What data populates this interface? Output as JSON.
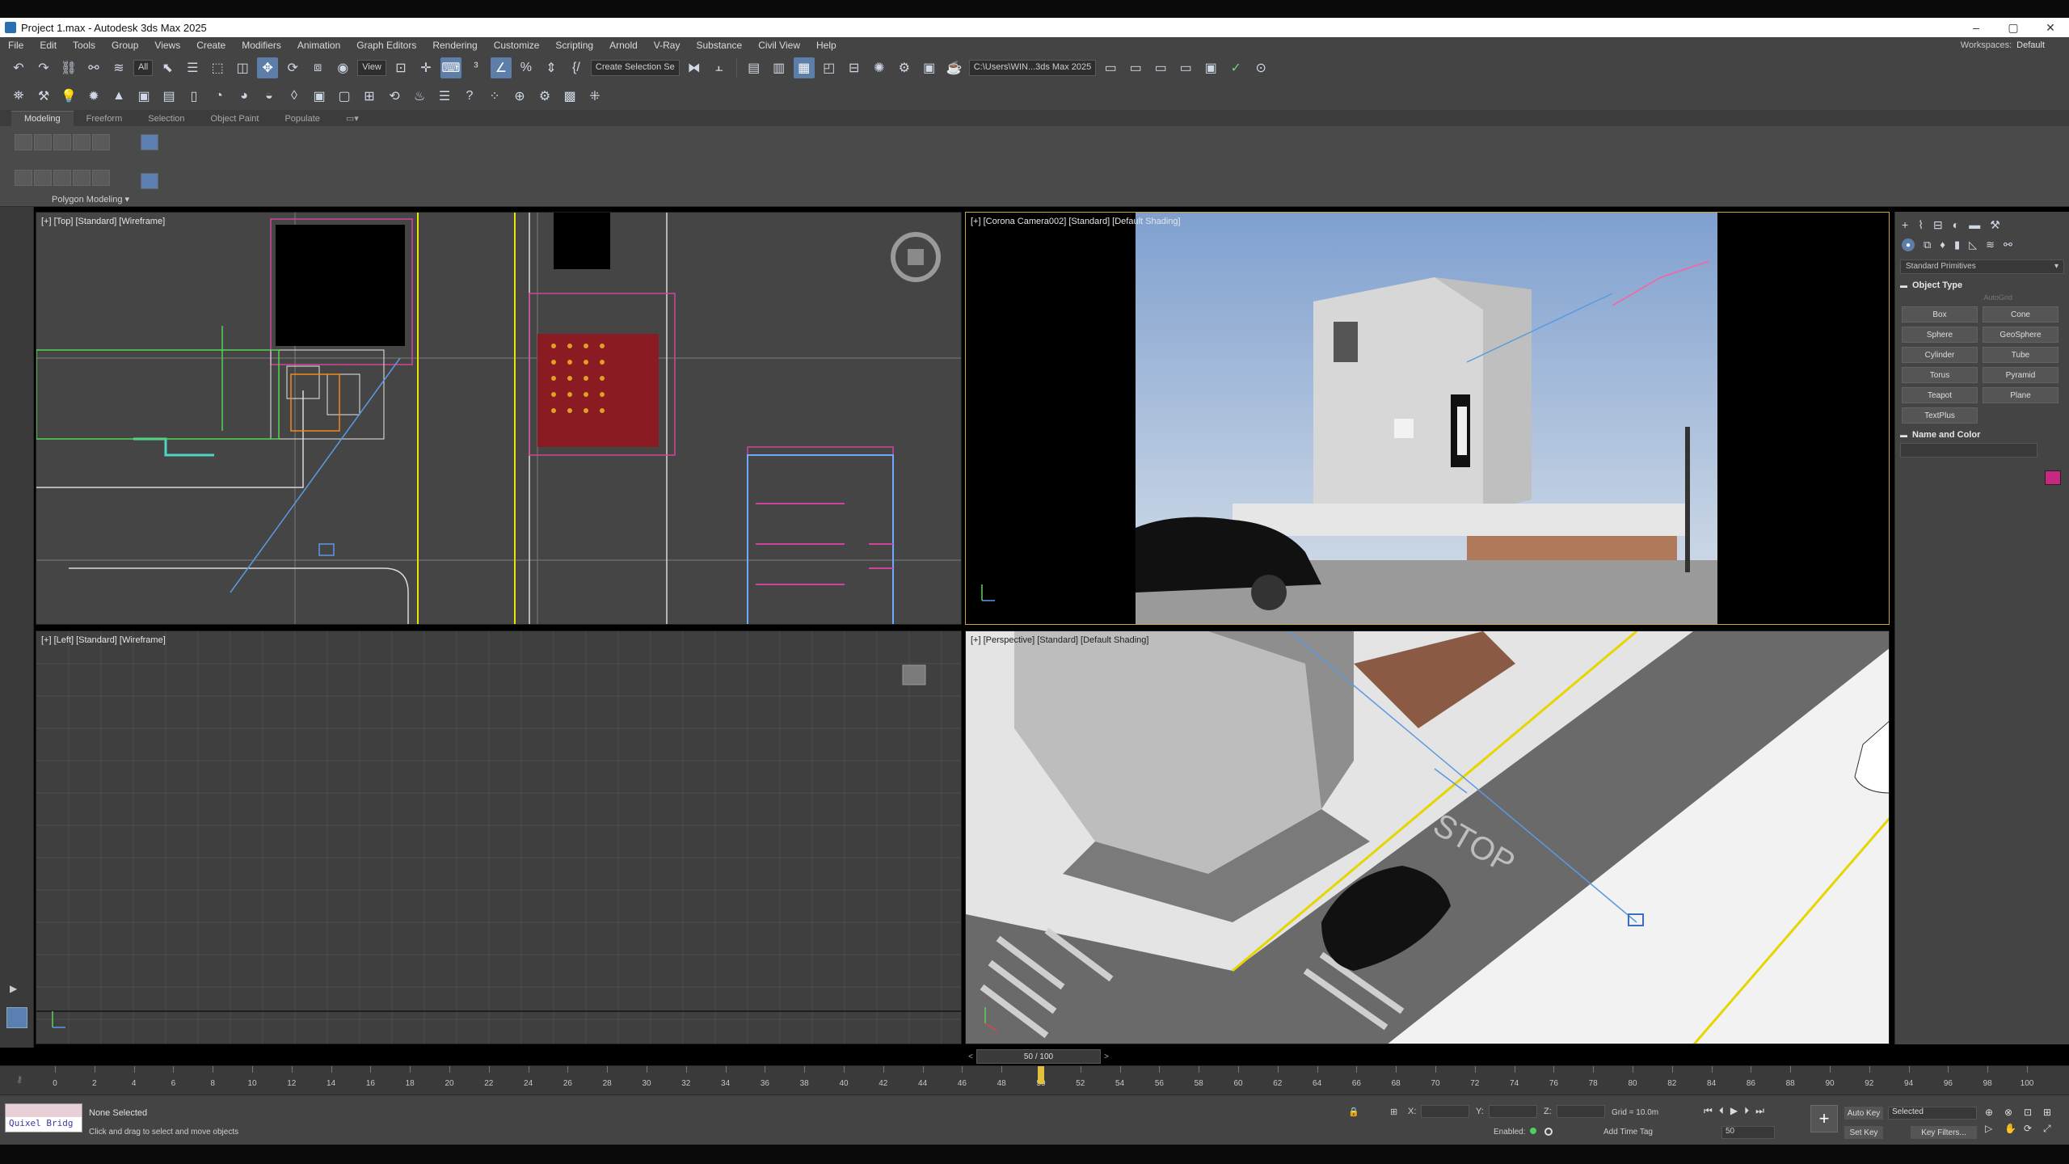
{
  "window": {
    "title": "Project 1.max - Autodesk 3ds Max 2025",
    "controls": [
      "–",
      "▢",
      "✕"
    ]
  },
  "menu": {
    "items": [
      "File",
      "Edit",
      "Tools",
      "Group",
      "Views",
      "Create",
      "Modifiers",
      "Animation",
      "Graph Editors",
      "Rendering",
      "Customize",
      "Scripting",
      "Arnold",
      "V-Ray",
      "Substance",
      "Civil View",
      "Help"
    ],
    "workspaces_label": "Workspaces:",
    "workspaces_value": "Default"
  },
  "toolbar": {
    "selection_filter": "All",
    "ref_coord": "View",
    "named_selection": "Create Selection Se",
    "project_path": "C:\\Users\\WIN...3ds Max 2025"
  },
  "ribbon": {
    "tabs": [
      "Modeling",
      "Freeform",
      "Selection",
      "Object Paint",
      "Populate"
    ],
    "active_tab": "Modeling",
    "panel_label": "Polygon Modeling"
  },
  "viewports": {
    "top_left": "[+] [Top] [Standard] [Wireframe]",
    "top_right": "[+] [Corona Camera002] [Standard] [Default Shading]",
    "bottom_left": "[+] [Left] [Standard] [Wireframe]",
    "bottom_right": "[+] [Perspective] [Standard] [Default Shading]"
  },
  "command_panel": {
    "category": "Standard Primitives",
    "object_type_title": "Object Type",
    "autogrid": "AutoGrid",
    "primitives": [
      "Box",
      "Cone",
      "Sphere",
      "GeoSphere",
      "Cylinder",
      "Tube",
      "Torus",
      "Pyramid",
      "Teapot",
      "Plane",
      "TextPlus"
    ],
    "name_color_title": "Name and Color",
    "object_color": "#c8287f"
  },
  "timeline": {
    "current": "50 / 100",
    "current_frame": 50,
    "total_frames": 100,
    "ticks": [
      "0",
      "2",
      "4",
      "6",
      "8",
      "10",
      "12",
      "14",
      "16",
      "18",
      "20",
      "22",
      "24",
      "26",
      "28",
      "30",
      "32",
      "34",
      "36",
      "38",
      "40",
      "42",
      "44",
      "46",
      "48",
      "50",
      "52",
      "54",
      "56",
      "58",
      "60",
      "62",
      "64",
      "66",
      "68",
      "70",
      "72",
      "74",
      "76",
      "78",
      "80",
      "82",
      "84",
      "86",
      "88",
      "90",
      "92",
      "94",
      "96",
      "98",
      "100"
    ]
  },
  "status": {
    "logo": "Quixel Bridg",
    "selection": "None Selected",
    "prompt": "Click and drag to select and move objects",
    "x_label": "X:",
    "y_label": "Y:",
    "z_label": "Z:",
    "grid": "Grid = 10.0m",
    "enabled_label": "Enabled:",
    "add_time_tag": "Add Time Tag",
    "frame_value": "50",
    "auto_key": "Auto Key",
    "set_key": "Set Key",
    "key_mode": "Selected",
    "key_filters": "Key Filters..."
  },
  "colors": {
    "ui_bg": "#444444",
    "accent_blue": "#5d7ea8",
    "active_viewport_border": "#c9a63d",
    "time_marker": "#e2c23c"
  }
}
